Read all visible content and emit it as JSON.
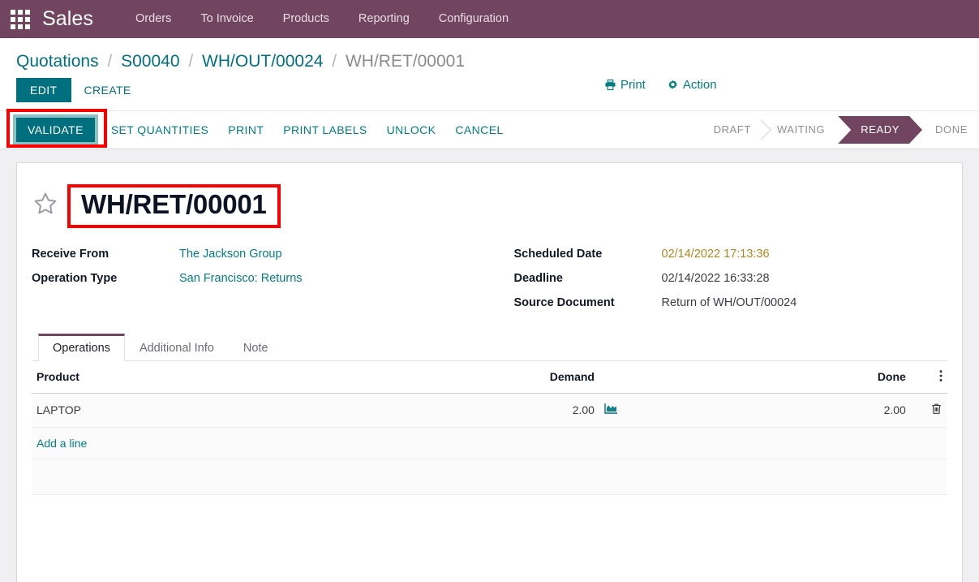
{
  "navbar": {
    "apps_icon": "apps-grid-icon",
    "brand": "Sales",
    "menu": [
      {
        "label": "Orders"
      },
      {
        "label": "To Invoice"
      },
      {
        "label": "Products"
      },
      {
        "label": "Reporting"
      },
      {
        "label": "Configuration"
      }
    ],
    "background_color": "#71455f"
  },
  "breadcrumb": {
    "items": [
      {
        "label": "Quotations",
        "current": false
      },
      {
        "label": "S00040",
        "current": false
      },
      {
        "label": "WH/OUT/00024",
        "current": false
      },
      {
        "label": "WH/RET/00001",
        "current": true
      }
    ],
    "separator": "/"
  },
  "control_panel": {
    "edit_label": "EDIT",
    "create_label": "CREATE",
    "print_label": "Print",
    "print_icon": "printer-icon",
    "action_label": "Action",
    "action_icon": "gear-icon"
  },
  "statusbar": {
    "buttons": [
      {
        "label": "VALIDATE",
        "primary": true,
        "highlighted": true
      },
      {
        "label": "SET QUANTITIES",
        "primary": false
      },
      {
        "label": "PRINT",
        "primary": false
      },
      {
        "label": "PRINT LABELS",
        "primary": false
      },
      {
        "label": "UNLOCK",
        "primary": false
      },
      {
        "label": "CANCEL",
        "primary": false
      }
    ],
    "stages": [
      {
        "label": "DRAFT",
        "active": false
      },
      {
        "label": "WAITING",
        "active": false
      },
      {
        "label": "READY",
        "active": true
      },
      {
        "label": "DONE",
        "active": false
      }
    ],
    "active_stage_color": "#71455f",
    "primary_button_color": "#00707f",
    "highlight_color": "#fc0000"
  },
  "record": {
    "star_icon": "star-outline-icon",
    "title": "WH/RET/00001",
    "title_highlighted": true,
    "fields_left": [
      {
        "label": "Receive From",
        "value": "The Jackson Group",
        "style": "link"
      },
      {
        "label": "Operation Type",
        "value": "San Francisco: Returns",
        "style": "link"
      }
    ],
    "fields_right": [
      {
        "label": "Scheduled Date",
        "value": "02/14/2022 17:13:36",
        "style": "warn"
      },
      {
        "label": "Deadline",
        "value": "02/14/2022 16:33:28",
        "style": "plain"
      },
      {
        "label": "Source Document",
        "value": "Return of WH/OUT/00024",
        "style": "plain"
      }
    ]
  },
  "notebook": {
    "tabs": [
      {
        "label": "Operations",
        "active": true
      },
      {
        "label": "Additional Info",
        "active": false
      },
      {
        "label": "Note",
        "active": false
      }
    ]
  },
  "operations_table": {
    "columns": {
      "product": "Product",
      "demand": "Demand",
      "done": "Done"
    },
    "options_icon": "vertical-dots-icon",
    "rows": [
      {
        "product": "LAPTOP",
        "demand": "2.00",
        "detail_icon": "area-chart-icon",
        "done": "2.00",
        "delete_icon": "trash-icon"
      }
    ],
    "add_line_label": "Add a line"
  }
}
